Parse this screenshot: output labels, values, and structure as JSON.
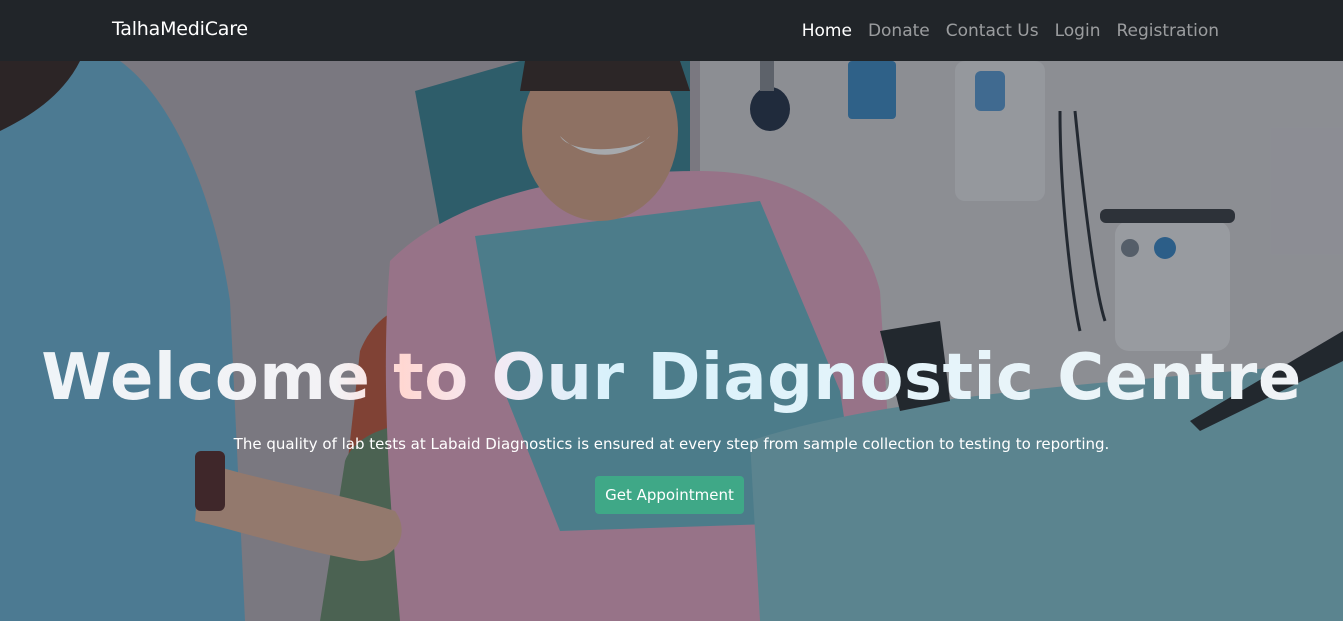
{
  "navbar": {
    "brand": "TalhaMediCare",
    "links": [
      {
        "label": "Home",
        "active": true
      },
      {
        "label": "Donate",
        "active": false
      },
      {
        "label": "Contact Us",
        "active": false
      },
      {
        "label": "Login",
        "active": false
      },
      {
        "label": "Registration",
        "active": false
      }
    ]
  },
  "hero": {
    "title": "Welcome to Our Diagnostic Centre",
    "subtitle": "The quality of lab tests at Labaid Diagnostics is ensured at every step from sample collection to testing to reporting.",
    "cta_label": "Get Appointment"
  },
  "colors": {
    "navbar_bg": "#212529",
    "cta_bg": "#3fa887",
    "link_active": "#ffffff",
    "link_inactive": "rgba(255,255,255,0.55)"
  }
}
